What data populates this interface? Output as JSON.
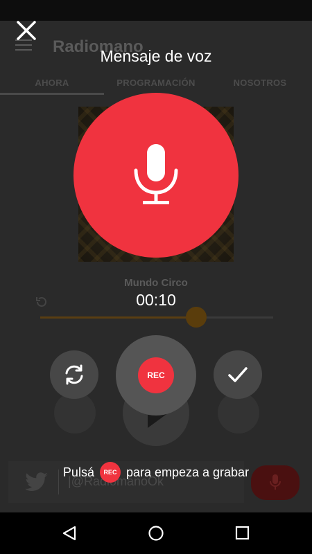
{
  "app": {
    "title": "Radiomano",
    "tabs": [
      "AHORA",
      "PROGRAMACIÓN",
      "NOSOTROS"
    ],
    "song_title": "Mundo Circo",
    "progress_fraction": 0.67,
    "twitter_handle": "|@RadiomanoOk"
  },
  "overlay": {
    "title": "Mensaje de voz",
    "timer": "00:10",
    "rec_label": "REC",
    "hint_before": "Pulsá",
    "hint_badge": "REC",
    "hint_after": "para empeza a grabar"
  },
  "colors": {
    "record_red": "#f0333f",
    "button_gray": "#474747"
  },
  "icons": [
    "close-icon",
    "microphone-icon",
    "reset-icon",
    "check-icon",
    "back-icon",
    "home-icon",
    "recents-icon"
  ]
}
